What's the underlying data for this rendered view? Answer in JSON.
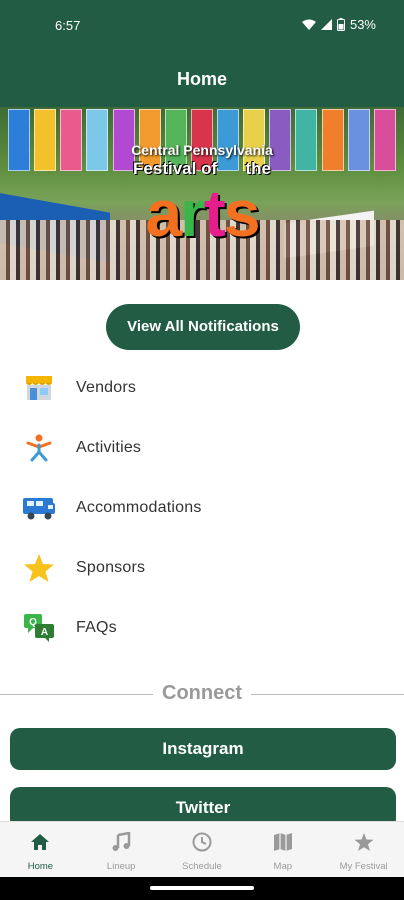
{
  "status_bar": {
    "time": "6:57",
    "battery": "53%"
  },
  "header": {
    "title": "Home"
  },
  "banner": {
    "logo_top": "Central Pennsylvania",
    "logo_mid": "Festival of      the",
    "logo_word": [
      "a",
      "r",
      "t",
      "s"
    ],
    "logo_colors": [
      "#f37021",
      "#3ab54a",
      "#e61e8c",
      "#f37021"
    ],
    "flag_colors": [
      "#2d7ed8",
      "#f3c12b",
      "#e95b8d",
      "#7bc8e8",
      "#b14ad1",
      "#f29a2e",
      "#55b35a",
      "#d8344c",
      "#3c9ad6",
      "#e8d04a",
      "#8a5cc2",
      "#41b5a3",
      "#ef7f2a",
      "#6a90e0",
      "#d94e9b"
    ]
  },
  "notifications_button": {
    "label": "View All Notifications"
  },
  "menu": {
    "items": [
      {
        "label": "Vendors",
        "icon": "storefront-icon"
      },
      {
        "label": "Activities",
        "icon": "person-activity-icon"
      },
      {
        "label": "Accommodations",
        "icon": "rv-camper-icon"
      },
      {
        "label": "Sponsors",
        "icon": "star-icon"
      },
      {
        "label": "FAQs",
        "icon": "qa-chat-icon"
      }
    ]
  },
  "connect": {
    "heading": "Connect",
    "buttons": [
      {
        "label": "Instagram"
      },
      {
        "label": "Twitter"
      }
    ]
  },
  "bottom_nav": {
    "items": [
      {
        "label": "Home",
        "icon": "home-icon",
        "active": true
      },
      {
        "label": "Lineup",
        "icon": "music-note-icon",
        "active": false
      },
      {
        "label": "Schedule",
        "icon": "clock-icon",
        "active": false
      },
      {
        "label": "Map",
        "icon": "map-icon",
        "active": false
      },
      {
        "label": "My Festival",
        "icon": "star-icon",
        "active": false
      }
    ]
  },
  "colors": {
    "primary": "#225c45",
    "nav_inactive": "#9a9a9a",
    "connect_text": "#9a9a9a"
  }
}
